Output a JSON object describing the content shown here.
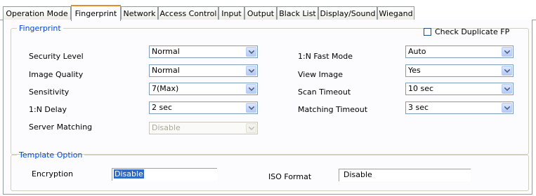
{
  "tabs": [
    {
      "label": "Operation Mode",
      "active": false
    },
    {
      "label": "Fingerprint",
      "active": true
    },
    {
      "label": "Network",
      "active": false
    },
    {
      "label": "Access Control",
      "active": false
    },
    {
      "label": "Input",
      "active": false
    },
    {
      "label": "Output",
      "active": false
    },
    {
      "label": "Black List",
      "active": false
    },
    {
      "label": "Display/Sound",
      "active": false
    },
    {
      "label": "Wiegand",
      "active": false
    }
  ],
  "fingerprint": {
    "legend": "Fingerprint",
    "check_duplicate_label": "Check Duplicate FP",
    "check_duplicate_checked": false,
    "security_level": {
      "label": "Security Level",
      "value": "Normal"
    },
    "image_quality": {
      "label": "Image Quality",
      "value": "Normal"
    },
    "sensitivity": {
      "label": "Sensitivity",
      "value": "7(Max)"
    },
    "n_delay": {
      "label": "1:N Delay",
      "value": "2 sec"
    },
    "server_matching": {
      "label": "Server Matching",
      "value": "Disable",
      "enabled": false
    },
    "fast_mode": {
      "label": "1:N Fast Mode",
      "value": "Auto"
    },
    "view_image": {
      "label": "View Image",
      "value": "Yes"
    },
    "scan_timeout": {
      "label": "Scan Timeout",
      "value": "10 sec"
    },
    "matching_timeout": {
      "label": "Matching Timeout",
      "value": "3 sec"
    }
  },
  "template": {
    "legend": "Template Option",
    "encryption": {
      "label": "Encryption",
      "value": "Disable"
    },
    "iso_format": {
      "label": "ISO Format",
      "value": "Disable"
    }
  },
  "colors": {
    "legend_text": "#0046d5",
    "active_tab_accent": "#e68b2c",
    "selection": "#316ac5"
  }
}
